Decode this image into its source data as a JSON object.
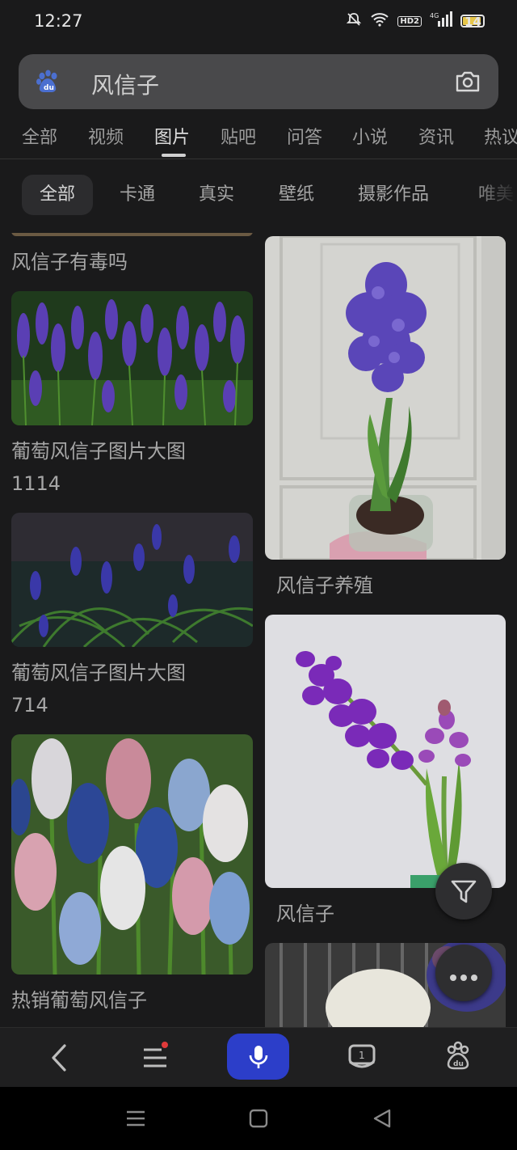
{
  "status": {
    "time": "12:27",
    "hd": "HD2",
    "signal": "4G",
    "battery": "14"
  },
  "search": {
    "query": "风信子"
  },
  "tabs": [
    "全部",
    "视频",
    "图片",
    "贴吧",
    "问答",
    "小说",
    "资讯",
    "热议"
  ],
  "active_tab": "图片",
  "chips": [
    "全部",
    "卡通",
    "真实",
    "壁纸",
    "摄影作品",
    "唯美"
  ],
  "results": {
    "left": [
      {
        "caption": "风信子有毒吗"
      },
      {
        "caption": "葡萄风信子图片大图",
        "count": "1114"
      },
      {
        "caption": "葡萄风信子图片大图",
        "count": "714"
      },
      {
        "caption": "热销葡萄风信子"
      }
    ],
    "right": [
      {
        "caption": "风信子养殖"
      },
      {
        "caption": "风信子"
      },
      {
        "caption": ""
      }
    ]
  },
  "colors": {
    "background": "#1a1a1b",
    "accent": "#2c3ec9",
    "notification": "#e03a3a"
  },
  "icons": [
    "baidu-paw-icon",
    "camera-icon",
    "filter-icon",
    "more-icon",
    "back-icon",
    "menu-icon",
    "mic-icon",
    "tabs-icon",
    "baidu-home-icon"
  ]
}
